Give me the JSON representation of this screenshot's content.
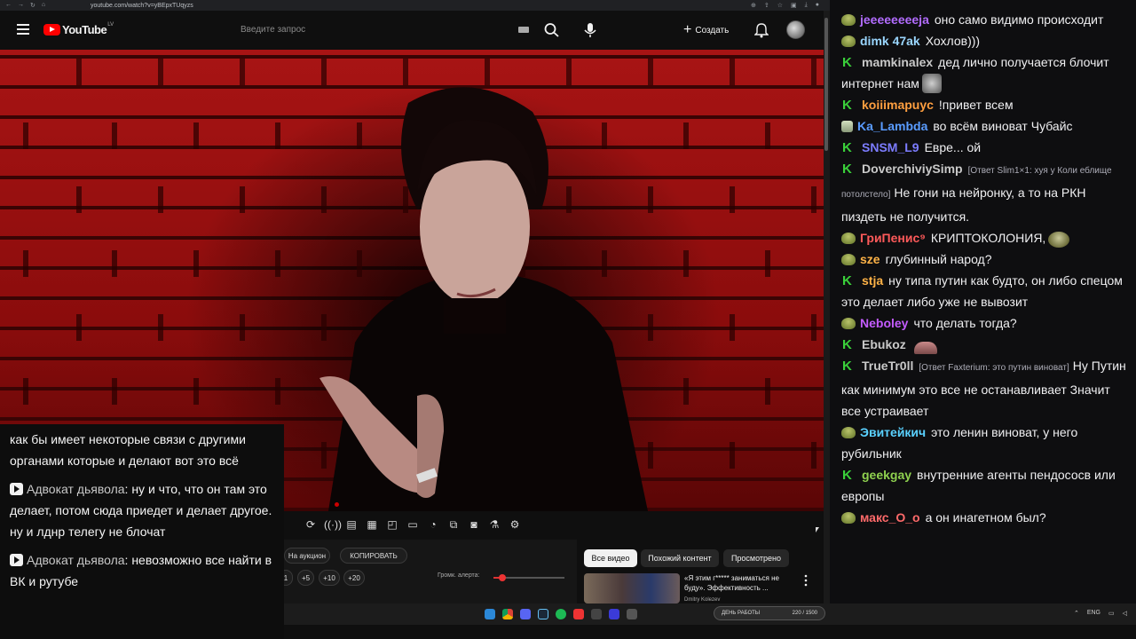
{
  "browser": {
    "url": "youtube.com/watch?v=yBEpxTUqyzs",
    "nav_icons": [
      "back-icon",
      "forward-icon",
      "reload-icon",
      "home-icon"
    ]
  },
  "header": {
    "logo_text": "YouTube",
    "logo_country": "LV",
    "search_placeholder": "Введите запрос",
    "create_label": "Создать"
  },
  "controls": {
    "icons": [
      "loop-icon",
      "broadcast-icon",
      "screen-icon",
      "frames-icon",
      "pip-icon",
      "miniplayer-icon",
      "speed-icon",
      "clip-icon",
      "camera-icon",
      "filter-icon",
      "settings-icon"
    ],
    "auction_label": "На аукцион",
    "copy_label": "КОПИРОВАТЬ",
    "step_buttons": [
      "1",
      "+5",
      "+10",
      "+20"
    ],
    "volume_label": "Громк. алерта:",
    "volume_level": 0.12
  },
  "chips": {
    "all": "Все видео",
    "similar": "Похожий контент",
    "watched": "Просмотрено"
  },
  "recommendation": {
    "title": "«Я этим г***** заниматься не буду». Эффективность ...",
    "channel": "Dmitry Kolezev"
  },
  "taskbar": {
    "widget_left": "ДЕНЬ РАБОТЫ",
    "widget_right": "220 / 1500",
    "lang": "ENG",
    "icons": [
      "windows-icon",
      "chrome-icon",
      "discord-icon",
      "steam-icon",
      "spotify-icon",
      "obs-icon",
      "media-icon",
      "telegram-icon",
      "app-icon"
    ]
  },
  "subtitles": [
    {
      "user": "",
      "text": "как бы имеет некоторые связи с другими органами которые и делают вот это всё"
    },
    {
      "user": "Адвокат дьявола",
      "text": "ну и что, что он там это делает, потом сюда приедет и делает другое. ну и лднр телегу не блочат"
    },
    {
      "user": "Адвокат дьявола",
      "text": "невозможно все найти в ВК и рутубе"
    }
  ],
  "chat": [
    {
      "badge": "pepe",
      "user": "jeeeeeeeeja",
      "color": "#b26cff",
      "reply": "",
      "text": "оно само видимо происходит",
      "emote": ""
    },
    {
      "badge": "pepe",
      "user": "dimk 47ak",
      "color": "#9ad6ff",
      "reply": "",
      "text": "Хохлов)))",
      "emote": ""
    },
    {
      "badge": "green",
      "user": "mamkinalex",
      "color": "#c9c9c9",
      "reply": "",
      "text": "дед лично получается блочит интернет нам",
      "emote": "grey"
    },
    {
      "badge": "green",
      "user": "koiiimapuyc",
      "color": "#ff9f40",
      "reply": "",
      "text": "!привет всем",
      "emote": ""
    },
    {
      "badge": "pepe-alt",
      "user": "Ka_Lambda",
      "color": "#5a9cff",
      "reply": "",
      "text": "во всём виноват Чубайс",
      "emote": ""
    },
    {
      "badge": "green",
      "user": "SNSM_L9",
      "color": "#7c7cff",
      "reply": "",
      "text": "Евре... ой",
      "emote": ""
    },
    {
      "badge": "green",
      "user": "DoverchiviySimp",
      "color": "#c9c9c9",
      "reply": "[Ответ Slim1×1: хуя у Коли еблище потолстело]",
      "text": "Не гони на нейронку, а то на РКН пиздеть не получится.",
      "emote": ""
    },
    {
      "badge": "pepe",
      "user": "ГриПенис⁹",
      "color": "#ff5a5a",
      "reply": "",
      "text": "КРИПТОКОЛОНИЯ,",
      "emote": "pepe"
    },
    {
      "badge": "pepe",
      "user": "sze",
      "color": "#ffb347",
      "reply": "",
      "text": "глубинный народ?",
      "emote": ""
    },
    {
      "badge": "green",
      "user": "stja",
      "color": "#ffb347",
      "reply": "",
      "text": "ну типа путин как будто, он либо спецом это делает либо уже не вывозит",
      "emote": ""
    },
    {
      "badge": "pepe",
      "user": "Neboley",
      "color": "#c45cff",
      "reply": "",
      "text": "что делать тогда?",
      "emote": ""
    },
    {
      "badge": "green",
      "user": "Ebukoz",
      "color": "#c9c9c9",
      "reply": "",
      "text": "",
      "emote": "hand"
    },
    {
      "badge": "green",
      "user": "TrueTr0ll",
      "color": "#c9c9c9",
      "reply": "[Ответ Faxterium: это путин виноват]",
      "text": "Ну Путин как минимум это все не останавливает Значит все устраивает",
      "emote": ""
    },
    {
      "badge": "pepe",
      "user": "Эвитейкич",
      "color": "#5ad1ff",
      "reply": "",
      "text": "это ленин виноват, у него рубильник",
      "emote": ""
    },
    {
      "badge": "green",
      "user": "geekgay",
      "color": "#8fd14f",
      "reply": "",
      "text": "внутренние агенты пендососв или европы",
      "emote": ""
    },
    {
      "badge": "pepe",
      "user": "макс_О_о",
      "color": "#ff6a6a",
      "reply": "",
      "text": "а он инагетном был?",
      "emote": ""
    }
  ]
}
